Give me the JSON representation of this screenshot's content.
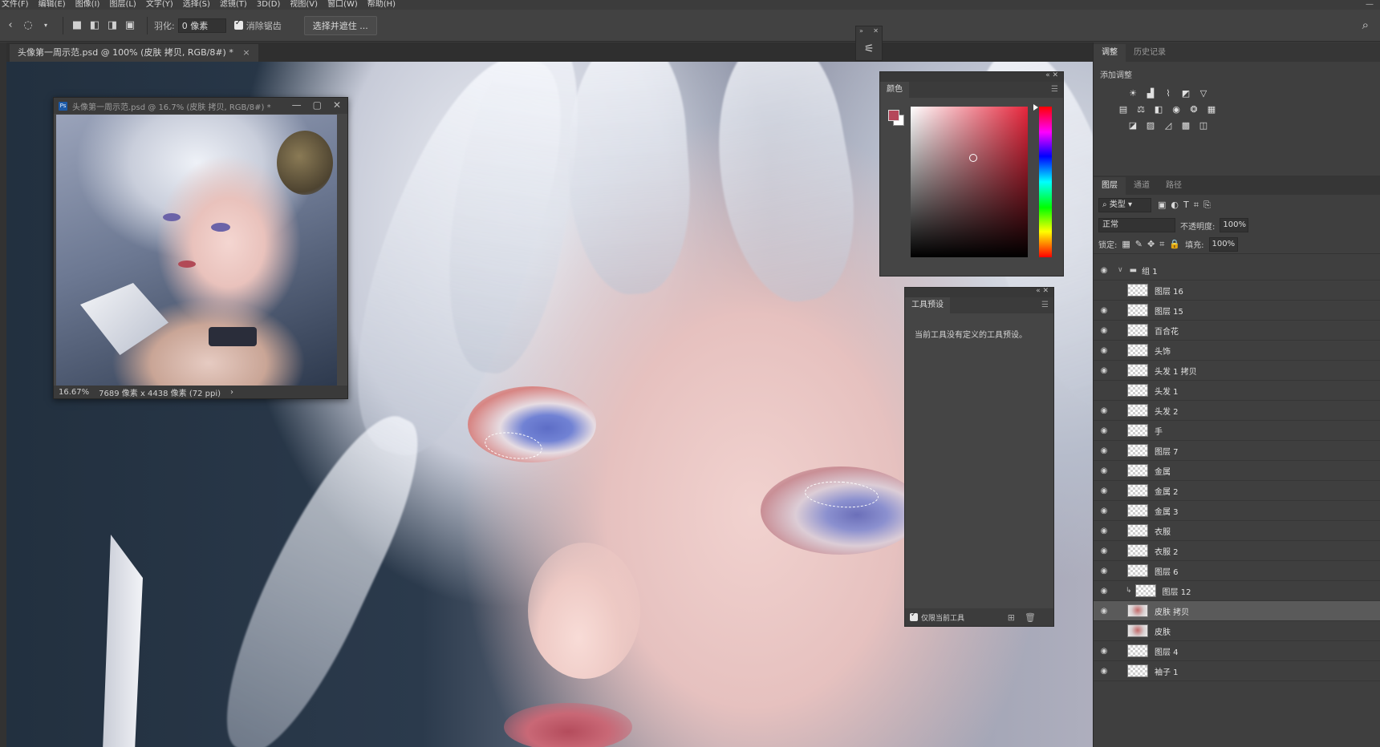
{
  "menu": [
    "文件(F)",
    "编辑(E)",
    "图像(I)",
    "图层(L)",
    "文字(Y)",
    "选择(S)",
    "滤镜(T)",
    "3D(D)",
    "视图(V)",
    "窗口(W)",
    "帮助(H)"
  ],
  "options": {
    "feather_label": "羽化:",
    "feather_value": "0 像素",
    "antialias_label": "消除锯齿",
    "select_mask_button": "选择并遮住 ..."
  },
  "document": {
    "tab_title": "头像第一周示范.psd @ 100% (皮肤 拷贝, RGB/8#) *",
    "tab_close": "×"
  },
  "navigator": {
    "title": "头像第一周示范.psd @ 16.7% (皮肤 拷贝, RGB/8#) *",
    "ps_badge": "Ps",
    "zoom": "16.67%",
    "doc_info": "7689 像素 x 4438 像素 (72 ppi)",
    "arrow": "›"
  },
  "color_panel": {
    "tab": "颜色",
    "foreground_color": "#b5475a",
    "background_color": "#ffffff"
  },
  "presets_panel": {
    "tab": "工具预设",
    "empty_message": "当前工具没有定义的工具预设。",
    "current_tool_only": "仅限当前工具"
  },
  "adjust_panel": {
    "tabs": [
      "调整",
      "历史记录"
    ],
    "add_adjustment": "添加调整"
  },
  "layers_panel": {
    "tabs": [
      "图层",
      "通道",
      "路径"
    ],
    "filter_kind": "类型",
    "blend_mode": "正常",
    "opacity_label": "不透明度:",
    "opacity_value": "100%",
    "lock_label": "锁定:",
    "fill_label": "填充:",
    "fill_value": "100%",
    "layers": [
      {
        "name": "组 1",
        "type": "group",
        "visible": true
      },
      {
        "name": "图层 16",
        "type": "layer",
        "visible": false
      },
      {
        "name": "图层 15",
        "type": "layer",
        "visible": true
      },
      {
        "name": "百合花",
        "type": "layer",
        "visible": true
      },
      {
        "name": "头饰",
        "type": "layer",
        "visible": true
      },
      {
        "name": "头发 1 拷贝",
        "type": "layer",
        "visible": true
      },
      {
        "name": "头发 1",
        "type": "layer",
        "visible": false
      },
      {
        "name": "头发 2",
        "type": "layer",
        "visible": true
      },
      {
        "name": "手",
        "type": "layer",
        "visible": true
      },
      {
        "name": "图层 7",
        "type": "layer",
        "visible": true
      },
      {
        "name": "金属",
        "type": "layer",
        "visible": true
      },
      {
        "name": "金属 2",
        "type": "layer",
        "visible": true
      },
      {
        "name": "金属 3",
        "type": "layer",
        "visible": true
      },
      {
        "name": "衣服",
        "type": "layer",
        "visible": true
      },
      {
        "name": "衣服 2",
        "type": "layer",
        "visible": true
      },
      {
        "name": "图层 6",
        "type": "layer",
        "visible": true
      },
      {
        "name": "图层 12",
        "type": "clipped",
        "visible": true
      },
      {
        "name": "皮肤 拷贝",
        "type": "portrait",
        "visible": true,
        "selected": true
      },
      {
        "name": "皮肤",
        "type": "portrait",
        "visible": false
      },
      {
        "name": "图层 4",
        "type": "layer",
        "visible": true
      },
      {
        "name": "袖子 1",
        "type": "layer",
        "visible": true
      }
    ]
  }
}
